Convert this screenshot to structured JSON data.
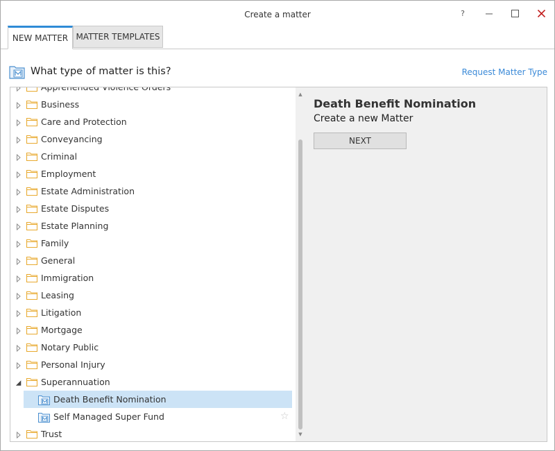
{
  "window": {
    "title": "Create a matter",
    "help_glyph": "?",
    "minimize_glyph": "—",
    "maximize_glyph": "☐",
    "close_glyph": "✕",
    "close_color": "#c21a1a"
  },
  "tabs": [
    {
      "label": "NEW MATTER",
      "active": true
    },
    {
      "label": "MATTER TEMPLATES",
      "active": false
    }
  ],
  "header": {
    "question": "What type of matter is this?",
    "request_link": "Request Matter Type",
    "icon": "matter-icon"
  },
  "tree": {
    "partial_top": "Apprehended Violence Orders",
    "categories": [
      {
        "label": "Business",
        "expanded": false
      },
      {
        "label": "Care and Protection",
        "expanded": false
      },
      {
        "label": "Conveyancing",
        "expanded": false
      },
      {
        "label": "Criminal",
        "expanded": false
      },
      {
        "label": "Employment",
        "expanded": false
      },
      {
        "label": "Estate Administration",
        "expanded": false
      },
      {
        "label": "Estate Disputes",
        "expanded": false
      },
      {
        "label": "Estate Planning",
        "expanded": false
      },
      {
        "label": "Family",
        "expanded": false
      },
      {
        "label": "General",
        "expanded": false
      },
      {
        "label": "Immigration",
        "expanded": false
      },
      {
        "label": "Leasing",
        "expanded": false
      },
      {
        "label": "Litigation",
        "expanded": false
      },
      {
        "label": "Mortgage",
        "expanded": false
      },
      {
        "label": "Notary Public",
        "expanded": false
      },
      {
        "label": "Personal Injury",
        "expanded": false
      },
      {
        "label": "Superannuation",
        "expanded": true,
        "children": [
          {
            "label": "Death Benefit Nomination",
            "selected": true
          },
          {
            "label": "Self Managed Super Fund",
            "selected": false,
            "favorite_icon": "star-outline-icon"
          }
        ]
      },
      {
        "label": "Trust",
        "expanded": false
      }
    ]
  },
  "detail": {
    "title": "Death Benefit Nomination",
    "subtitle": "Create a new Matter",
    "next_label": "NEXT"
  },
  "colors": {
    "accent": "#2f8bd6",
    "link": "#3b8ad8",
    "selection": "#cce3f6",
    "folder": "#e8a92e",
    "matter_icon": "#4a8fcf"
  }
}
